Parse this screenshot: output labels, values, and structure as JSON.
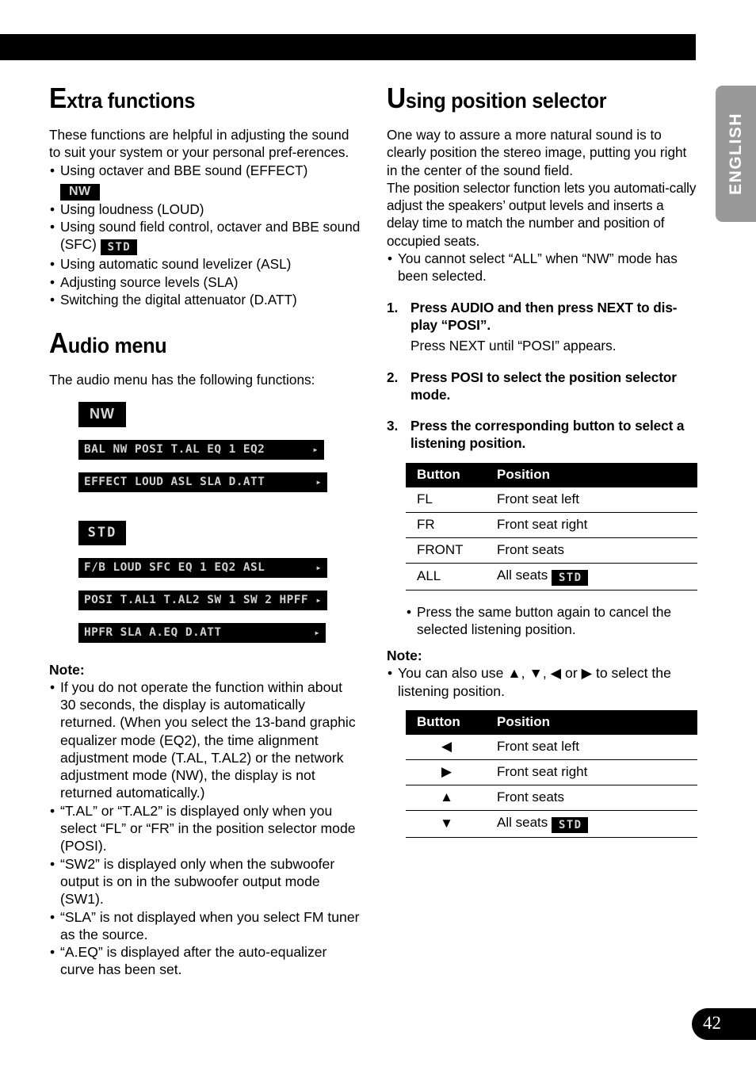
{
  "page": {
    "number": "42",
    "language_tab": "ENGLISH"
  },
  "left_column": {
    "section1": {
      "heading_initial": "E",
      "heading_rest": "xtra functions",
      "intro": "These functions are helpful in adjusting the sound to suit your system or your personal pref-erences.",
      "bullets": [
        {
          "text": "Using octaver and BBE sound (EFFECT)",
          "badge": "NW",
          "badge_style": "nw",
          "badge_on_new_line": true
        },
        {
          "text": "Using loudness (LOUD)",
          "badge": "",
          "badge_style": "",
          "badge_on_new_line": false
        },
        {
          "text": "Using sound field control, octaver and BBE sound (SFC)",
          "badge": "STD",
          "badge_style": "std",
          "badge_on_new_line": false
        },
        {
          "text": "Using automatic sound levelizer (ASL)",
          "badge": "",
          "badge_style": "",
          "badge_on_new_line": false
        },
        {
          "text": "Adjusting source levels (SLA)",
          "badge": "",
          "badge_style": "",
          "badge_on_new_line": false
        },
        {
          "text": "Switching the digital attenuator (D.ATT)",
          "badge": "",
          "badge_style": "",
          "badge_on_new_line": false
        }
      ]
    },
    "section2": {
      "heading_initial": "A",
      "heading_rest": "udio menu",
      "intro": "The audio menu has the following functions:",
      "nw_tag": "NW",
      "nw_bars": [
        {
          "text": "BAL  NW  POSI T.AL  EQ 1  EQ2",
          "arrow": "▸"
        },
        {
          "text": "EFFECT LOUD ASL   SLA  D.ATT",
          "arrow": "▸"
        }
      ],
      "std_tag": "STD",
      "std_bars": [
        {
          "text": "F/B  LOUD  SFC  EQ 1  EQ2  ASL",
          "arrow": "▸"
        },
        {
          "text": "POSI T.AL1 T.AL2 SW 1  SW 2  HPFF",
          "arrow": "▸"
        },
        {
          "text": "HPFR  SLA  A.EQ D.ATT",
          "arrow": "▸"
        }
      ]
    },
    "note": {
      "label": "Note:",
      "items": [
        "If you do not operate the function within about 30 seconds, the display is automatically returned. (When you select the 13-band graphic equalizer mode (EQ2), the time alignment adjustment mode (T.AL, T.AL2) or the network adjustment mode (NW), the display is not returned automatically.)",
        "“T.AL” or “T.AL2” is displayed only when you select “FL” or “FR” in the position selector mode (POSI).",
        "“SW2” is displayed only when the subwoofer output is on in the subwoofer output mode (SW1).",
        "“SLA” is not displayed when you select FM tuner as the source.",
        "“A.EQ” is displayed after the auto-equalizer curve has been set."
      ]
    }
  },
  "right_column": {
    "section": {
      "heading_initial": "U",
      "heading_rest": "sing position selector",
      "intro1": "One way to assure a more natural sound is to clearly position the stereo image, putting you right in the center of the sound field.",
      "intro2": "The position selector function lets you automati-cally adjust the speakers’ output levels and inserts a delay time to match the number and position of occupied seats.",
      "bullet1": "You cannot select “ALL” when “NW” mode has been selected."
    },
    "steps": [
      {
        "num": "1.",
        "title": "Press AUDIO and then press NEXT to dis-play “POSI”.",
        "sub": "Press NEXT until “POSI” appears."
      },
      {
        "num": "2.",
        "title": "Press POSI to select the position selector mode.",
        "sub": ""
      },
      {
        "num": "3.",
        "title": "Press the corresponding button to select a listening position.",
        "sub": ""
      }
    ],
    "table1": {
      "headers": [
        "Button",
        "Position"
      ],
      "rows": [
        {
          "button": "FL",
          "position": "Front seat left",
          "badge": ""
        },
        {
          "button": "FR",
          "position": "Front seat right",
          "badge": ""
        },
        {
          "button": "FRONT",
          "position": "Front seats",
          "badge": ""
        },
        {
          "button": "ALL",
          "position": "All seats",
          "badge": "STD"
        }
      ]
    },
    "after_table_bullet": "Press the same button again to cancel the selected listening position.",
    "note": {
      "label": "Note:",
      "item": "You can also use ▲, ▼, ◀ or ▶ to select the listening position."
    },
    "table2": {
      "headers": [
        "Button",
        "Position"
      ],
      "rows": [
        {
          "button": "◀",
          "position": "Front seat left",
          "badge": ""
        },
        {
          "button": "▶",
          "position": "Front seat right",
          "badge": ""
        },
        {
          "button": "▲",
          "position": "Front seats",
          "badge": ""
        },
        {
          "button": "▼",
          "position": "All seats",
          "badge": "STD"
        }
      ]
    }
  }
}
